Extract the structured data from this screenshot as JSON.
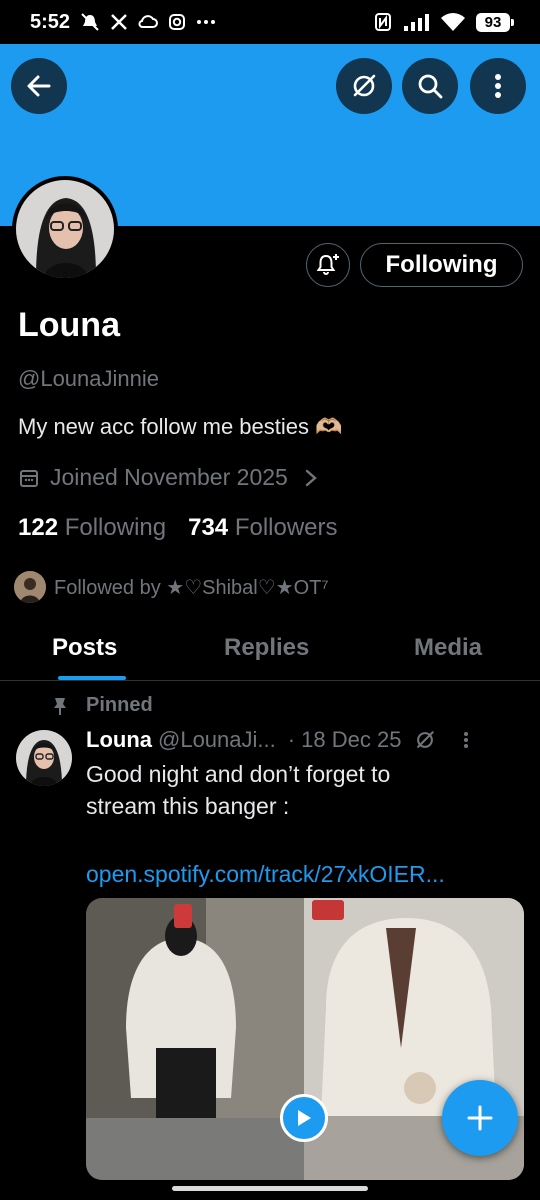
{
  "status_bar": {
    "time": "5:52",
    "battery": "93"
  },
  "profile": {
    "name": "Louna",
    "handle": "@LounaJinnie",
    "bio": "My new acc follow me besties 🫶🏼",
    "joined": "Joined November 2025",
    "following_count": "122",
    "following_label": "Following",
    "followers_count": "734",
    "followers_label": "Followers",
    "followed_by": "Followed by ★♡Shibal♡★OT⁷",
    "follow_button_label": "Following"
  },
  "tabs": [
    {
      "label": "Posts",
      "active": true
    },
    {
      "label": "Replies",
      "active": false
    },
    {
      "label": "Media",
      "active": false
    }
  ],
  "pinned_label": "Pinned",
  "post": {
    "author": "Louna",
    "handle": "@LounaJi...",
    "date": "· 18 Dec 25",
    "text_line1": "Good night and don’t forget to",
    "text_line2": "stream this banger :",
    "link": "open.spotify.com/track/27xkOIER..."
  },
  "colors": {
    "accent": "#1d9bf0",
    "background": "#000000",
    "muted": "#71767b"
  }
}
